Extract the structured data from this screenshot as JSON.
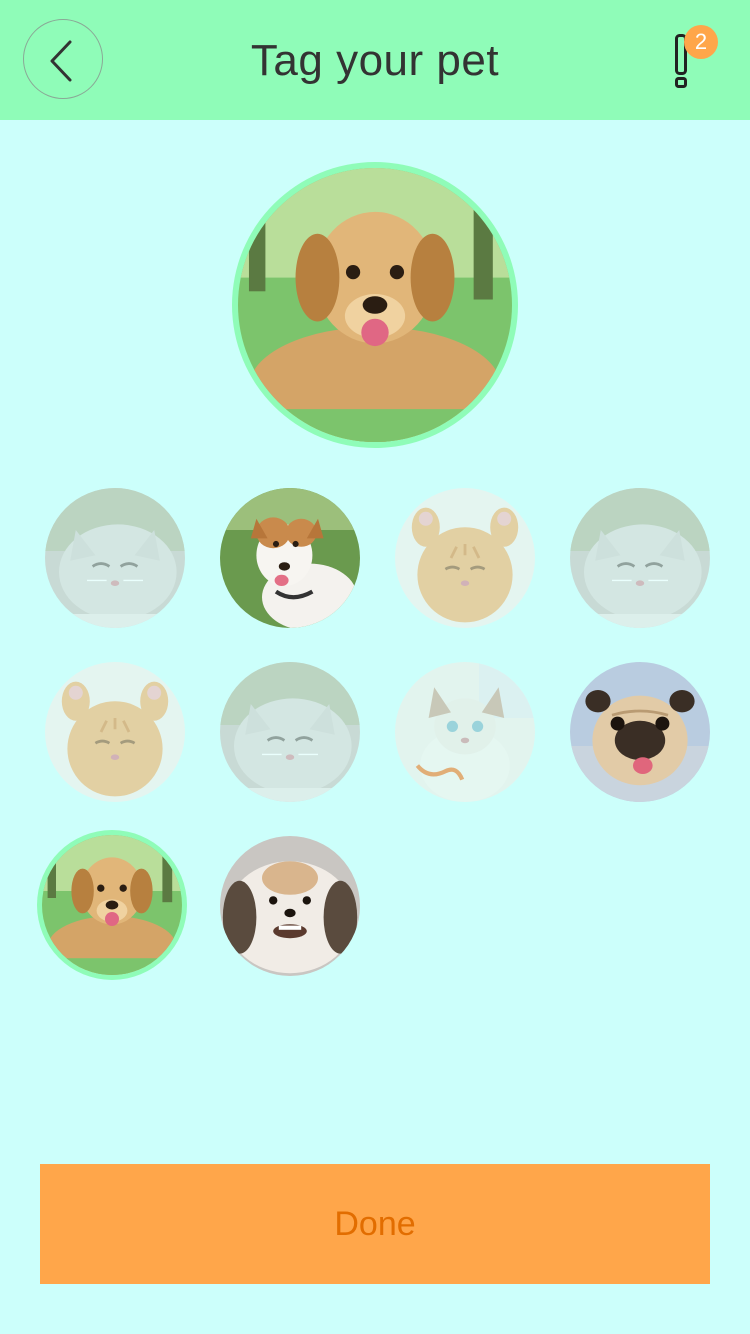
{
  "header": {
    "title": "Tag your pet",
    "back_icon": "chevron-left-icon",
    "alert_icon": "exclamation-icon",
    "notification_count": "2"
  },
  "hero": {
    "pet": "golden-retriever"
  },
  "grid": {
    "items": [
      {
        "pet": "grey-cat",
        "state": "unselected"
      },
      {
        "pet": "jack-russell-terrier",
        "state": "unselected-full"
      },
      {
        "pet": "orange-kitten",
        "state": "unselected"
      },
      {
        "pet": "grey-cat",
        "state": "unselected"
      },
      {
        "pet": "orange-kitten",
        "state": "unselected"
      },
      {
        "pet": "grey-cat",
        "state": "unselected"
      },
      {
        "pet": "siamese-kitten",
        "state": "unselected"
      },
      {
        "pet": "pug",
        "state": "unselected-full"
      },
      {
        "pet": "golden-retriever",
        "state": "selected"
      },
      {
        "pet": "shih-tzu",
        "state": "unselected-full"
      }
    ]
  },
  "footer": {
    "done_label": "Done"
  },
  "colors": {
    "header_bg": "#8ffcb8",
    "page_bg": "#ccfffb",
    "accent_orange": "#ffa64a",
    "done_text": "#e26d00",
    "selected_ring": "#8ffcb8"
  }
}
